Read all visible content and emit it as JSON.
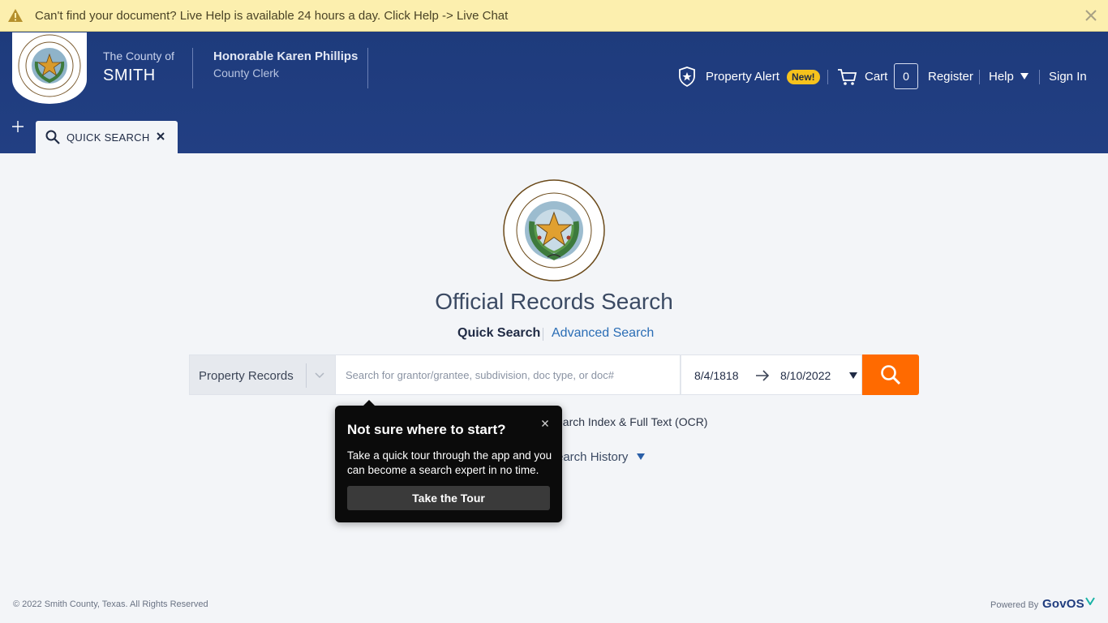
{
  "alert": {
    "message": "Can't find your document? Live Help is available 24 hours a day. Click Help -> Live Chat",
    "icon": "warning-icon",
    "background": "#fcefae"
  },
  "header": {
    "county_prefix": "The County of",
    "county_name": "SMITH",
    "clerk_name": "Honorable Karen Phillips",
    "clerk_title": "County Clerk",
    "background": "#1f3c7e",
    "nav": {
      "property_alert": "Property Alert",
      "new_badge": "New!",
      "cart": "Cart",
      "cart_count": "0",
      "register": "Register",
      "help": "Help",
      "sign_in": "Sign In"
    }
  },
  "tabs": [
    {
      "label": "QUICK SEARCH",
      "icon": "search-icon"
    }
  ],
  "main": {
    "title": "Official Records Search",
    "modes": {
      "quick": "Quick Search",
      "advanced": "Advanced Search"
    },
    "search": {
      "department": "Property Records",
      "placeholder": "Search for grantor/grantee, subdivision, doc type, or doc#",
      "value": "",
      "date_from": "8/4/1818",
      "date_to": "8/10/2022",
      "button_color": "#ff6a00"
    },
    "option_text": "earch Index & Full Text (OCR)",
    "history_text": "earch History"
  },
  "tooltip": {
    "title": "Not sure where to start?",
    "body": "Take a quick tour through the app and you can become a search expert in no time.",
    "button": "Take the Tour"
  },
  "footer": {
    "copyright": "© 2022 Smith County, Texas. All Rights Reserved",
    "powered_by": "Powered By",
    "brand": "GovOS"
  }
}
